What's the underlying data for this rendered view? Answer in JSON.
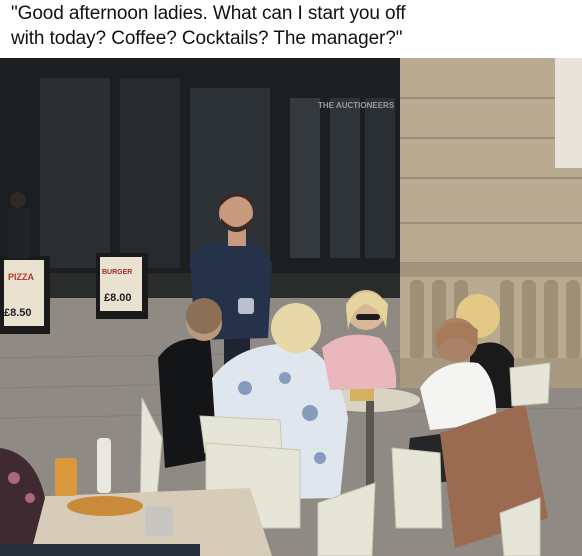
{
  "caption": {
    "line1": "\"Good afternoon ladies. What can I start you off",
    "line2": "with today? Coffee? Cocktails? The manager?\""
  },
  "photo": {
    "scene": "Waiter standing beside an outdoor cafe table with five seated women",
    "signs": {
      "left_board_top": "PIZZA",
      "left_board_price": "£8.50",
      "right_board_top": "BURGER",
      "right_board_price": "£8.00",
      "storefront_name": "THE AUCTIONEERS"
    },
    "colors": {
      "storefront": "#1c1f22",
      "stone": "#b9aa91",
      "pavement": "#8d8882",
      "waiter_shirt": "#26324a",
      "pink_top": "#e9b7bc",
      "floral_top": "#dfe6ee",
      "white_top": "#f4f4f2",
      "brown_cardigan": "#9a6b51",
      "chair": "#e6e6d8"
    }
  }
}
